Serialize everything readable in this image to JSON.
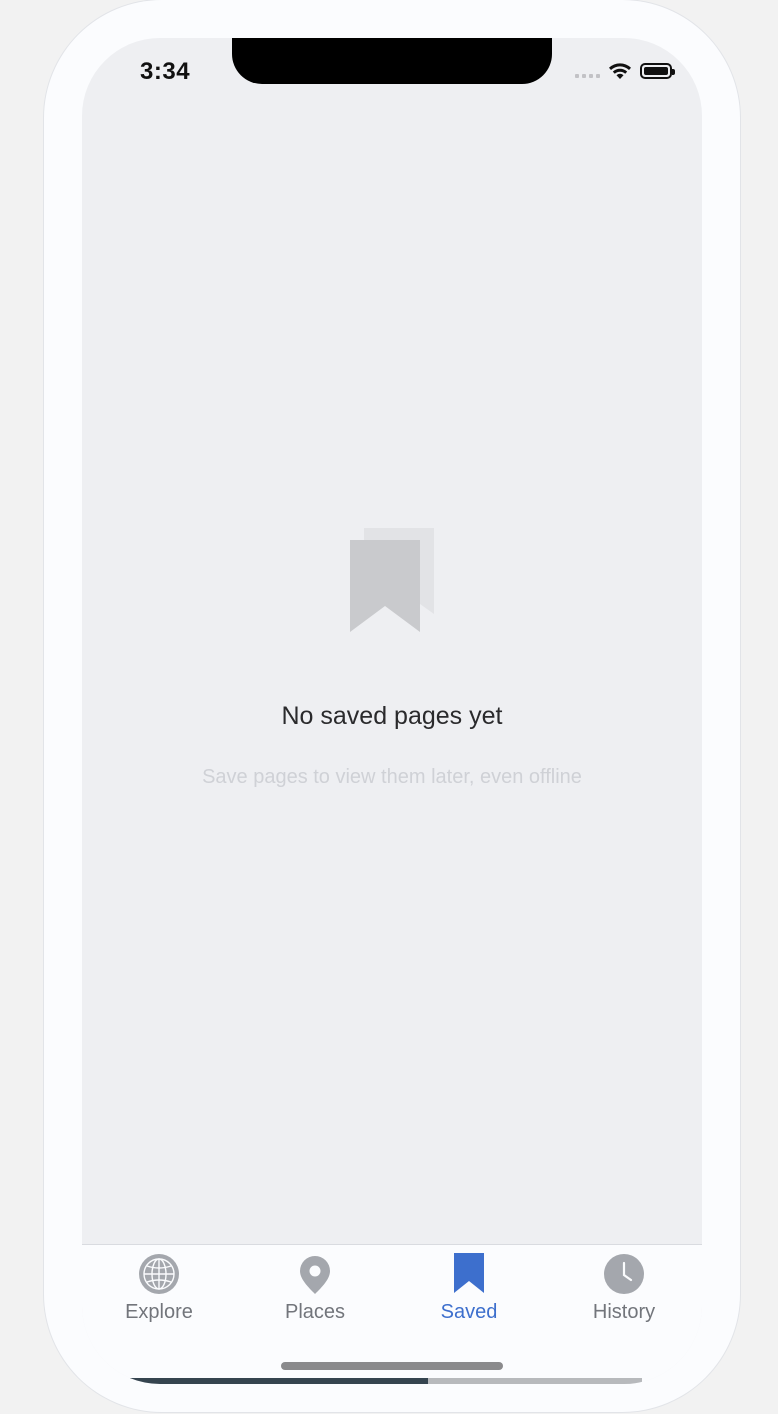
{
  "status_bar": {
    "time": "3:34"
  },
  "empty_state": {
    "title": "No saved pages yet",
    "subtitle": "Save pages to view them later, even offline"
  },
  "tabs": [
    {
      "label": "Explore",
      "icon": "globe-icon",
      "active": false
    },
    {
      "label": "Places",
      "icon": "map-pin-icon",
      "active": false
    },
    {
      "label": "Saved",
      "icon": "bookmark-icon",
      "active": true
    },
    {
      "label": "History",
      "icon": "clock-icon",
      "active": false
    }
  ],
  "colors": {
    "accent": "#3d6fcd",
    "inactive_icon": "#a4a7ad",
    "background": "#eeeff2"
  }
}
